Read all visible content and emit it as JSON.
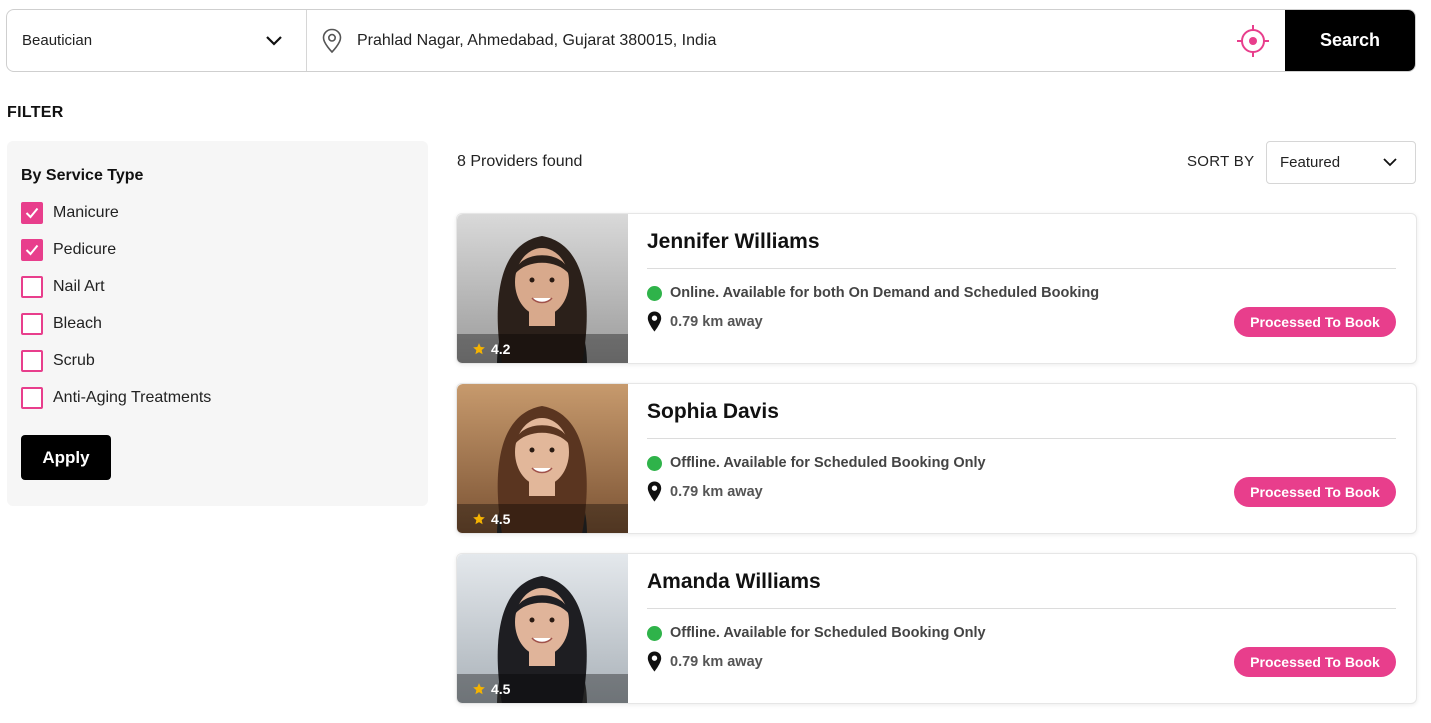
{
  "search": {
    "category": "Beautician",
    "location": "Prahlad Nagar, Ahmedabad, Gujarat 380015, India",
    "button_label": "Search"
  },
  "filter": {
    "heading": "FILTER",
    "group_title": "By Service Type",
    "options": [
      {
        "label": "Manicure",
        "checked": true
      },
      {
        "label": "Pedicure",
        "checked": true
      },
      {
        "label": "Nail Art",
        "checked": false
      },
      {
        "label": "Bleach",
        "checked": false
      },
      {
        "label": "Scrub",
        "checked": false
      },
      {
        "label": "Anti-Aging Treatments",
        "checked": false
      }
    ],
    "apply_label": "Apply"
  },
  "results": {
    "count_text": "8 Providers found",
    "sort_label": "SORT BY",
    "sort_value": "Featured"
  },
  "providers": [
    {
      "name": "Jennifer Williams",
      "rating": "4.2",
      "status": "Online. Available for both On Demand and Scheduled Booking",
      "distance": "0.79 km away",
      "button": "Processed To Book"
    },
    {
      "name": "Sophia Davis",
      "rating": "4.5",
      "status": "Offline. Available for Scheduled Booking Only",
      "distance": "0.79 km away",
      "button": "Processed To Book"
    },
    {
      "name": "Amanda Williams",
      "rating": "4.5",
      "status": "Offline. Available for Scheduled Booking Only",
      "distance": "0.79 km away",
      "button": "Processed To Book"
    }
  ],
  "colors": {
    "accent": "#e83e8c",
    "primary_button": "#000000",
    "status_dot": "#2fb34a",
    "star": "#f5b301"
  }
}
